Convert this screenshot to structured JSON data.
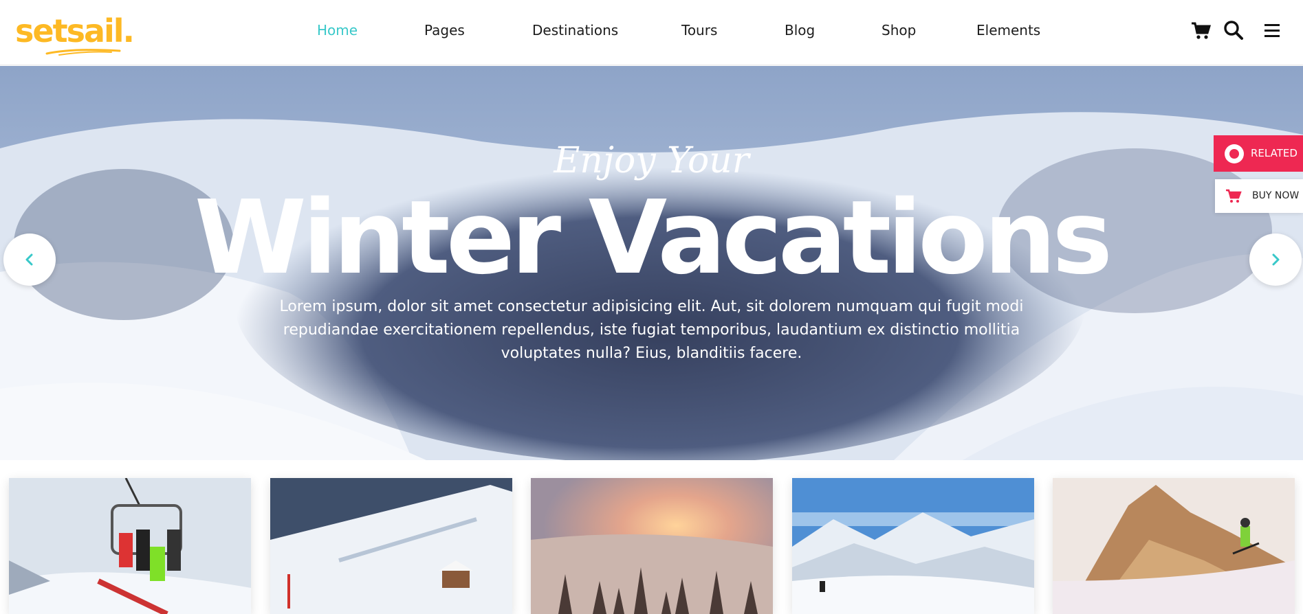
{
  "header": {
    "logo_text": "setsail.",
    "nav": [
      {
        "label": "Home",
        "active": true
      },
      {
        "label": "Pages"
      },
      {
        "label": "Destinations"
      },
      {
        "label": "Tours"
      },
      {
        "label": "Blog"
      },
      {
        "label": "Shop"
      },
      {
        "label": "Elements"
      }
    ],
    "icons": [
      "cart-icon",
      "search-icon",
      "menu-icon"
    ]
  },
  "hero": {
    "kicker": "Enjoy Your",
    "title": "Winter Vacations",
    "text": "Lorem ipsum, dolor sit amet consectetur adipisicing elit. Aut, sit dolorem numquam qui fugit modi repudiandae exercitationem repellendus, iste fugiat temporibus, laudantium ex distinctio mollitia voluptates nulla? Eius, blanditiis facere.",
    "prev_icon": "chevron-left-icon",
    "next_icon": "chevron-right-icon"
  },
  "side": {
    "related_label": "RELATED",
    "buy_label": "BUY NOW"
  },
  "cards": [
    {
      "subject": "chairlift with snowboarders"
    },
    {
      "subject": "snowy mountain slope with lodge"
    },
    {
      "subject": "sunset over snowy forest"
    },
    {
      "subject": "alpine ski valley"
    },
    {
      "subject": "skier on golden mountain"
    }
  ],
  "colors": {
    "brand": "#fdb924",
    "accent": "#38c8c9",
    "related": "#ee2852",
    "text": "#1c1c1c"
  }
}
